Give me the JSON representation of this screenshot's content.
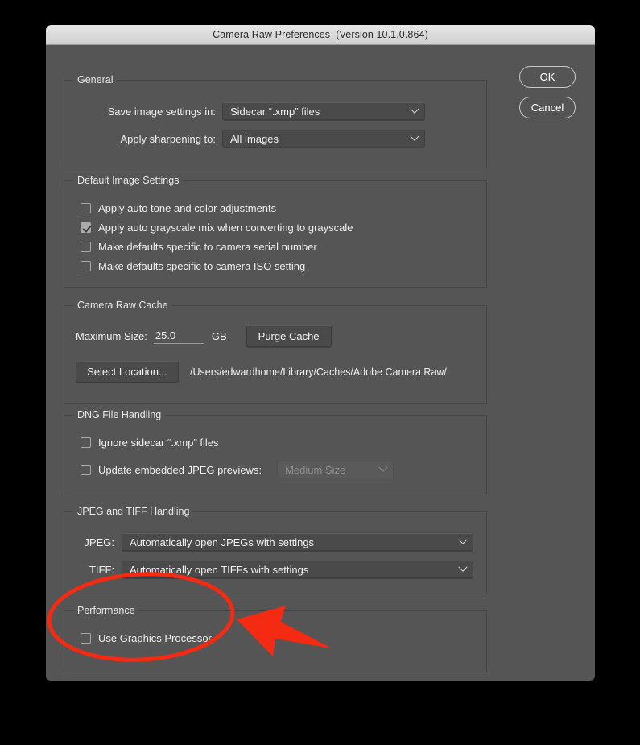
{
  "window": {
    "title": "Camera Raw Preferences  (Version 10.1.0.864)"
  },
  "buttons": {
    "ok": "OK",
    "cancel": "Cancel"
  },
  "groups": {
    "general": {
      "legend": "General",
      "save_label": "Save image settings in:",
      "save_value": "Sidecar “.xmp” files",
      "sharpen_label": "Apply sharpening to:",
      "sharpen_value": "All images"
    },
    "default_image_settings": {
      "legend": "Default Image Settings",
      "items": [
        {
          "label": "Apply auto tone and color adjustments",
          "checked": false
        },
        {
          "label": "Apply auto grayscale mix when converting to grayscale",
          "checked": true
        },
        {
          "label": "Make defaults specific to camera serial number",
          "checked": false
        },
        {
          "label": "Make defaults specific to camera ISO setting",
          "checked": false
        }
      ]
    },
    "camera_raw_cache": {
      "legend": "Camera Raw Cache",
      "max_size_label": "Maximum Size:",
      "max_size_value": "25.0",
      "unit": "GB",
      "purge_button": "Purge Cache",
      "select_location_button": "Select Location...",
      "path": "/Users/edwardhome/Library/Caches/Adobe Camera Raw/"
    },
    "dng_file_handling": {
      "legend": "DNG File Handling",
      "ignore_sidecar_label": "Ignore sidecar “.xmp” files",
      "ignore_sidecar_checked": false,
      "update_previews_label": "Update embedded JPEG previews:",
      "update_previews_checked": false,
      "preview_size_value": "Medium Size"
    },
    "jpeg_tiff_handling": {
      "legend": "JPEG and TIFF Handling",
      "jpeg_label": "JPEG:",
      "jpeg_value": "Automatically open JPEGs with settings",
      "tiff_label": "TIFF:",
      "tiff_value": "Automatically open TIFFs with settings"
    },
    "performance": {
      "legend": "Performance",
      "gpu_label": "Use Graphics Processor",
      "gpu_checked": false
    }
  },
  "annotations": {
    "highlight_color": "#f42a12",
    "ellipse_name": "red-ellipse-highlight",
    "arrow_name": "red-arrow-pointer"
  }
}
